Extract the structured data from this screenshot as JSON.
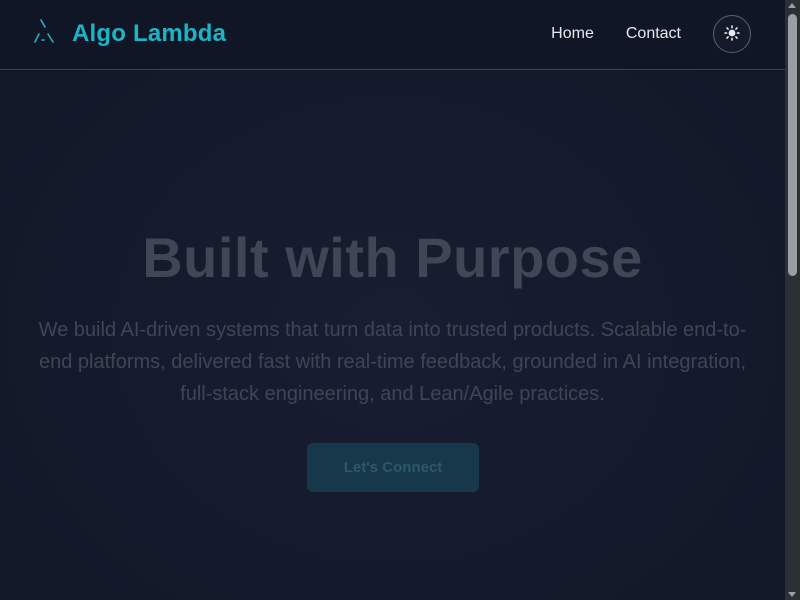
{
  "brand": {
    "name": "Algo Lambda",
    "logo_icon": "lambda-logo-icon"
  },
  "nav": {
    "links": [
      {
        "label": "Home"
      },
      {
        "label": "Contact"
      }
    ],
    "theme_toggle_icon": "sun-icon"
  },
  "hero": {
    "title": "Built with Purpose",
    "description": "We build AI-driven systems that turn data into trusted products. Scalable end-to-end platforms, delivered fast with real-time feedback, grounded in AI integration, full-stack engineering, and Lean/Agile practices.",
    "cta_label": "Let's Connect"
  },
  "colors": {
    "accent": "#1cb5c6",
    "background": "#151a2b",
    "navbar": "#111626"
  }
}
